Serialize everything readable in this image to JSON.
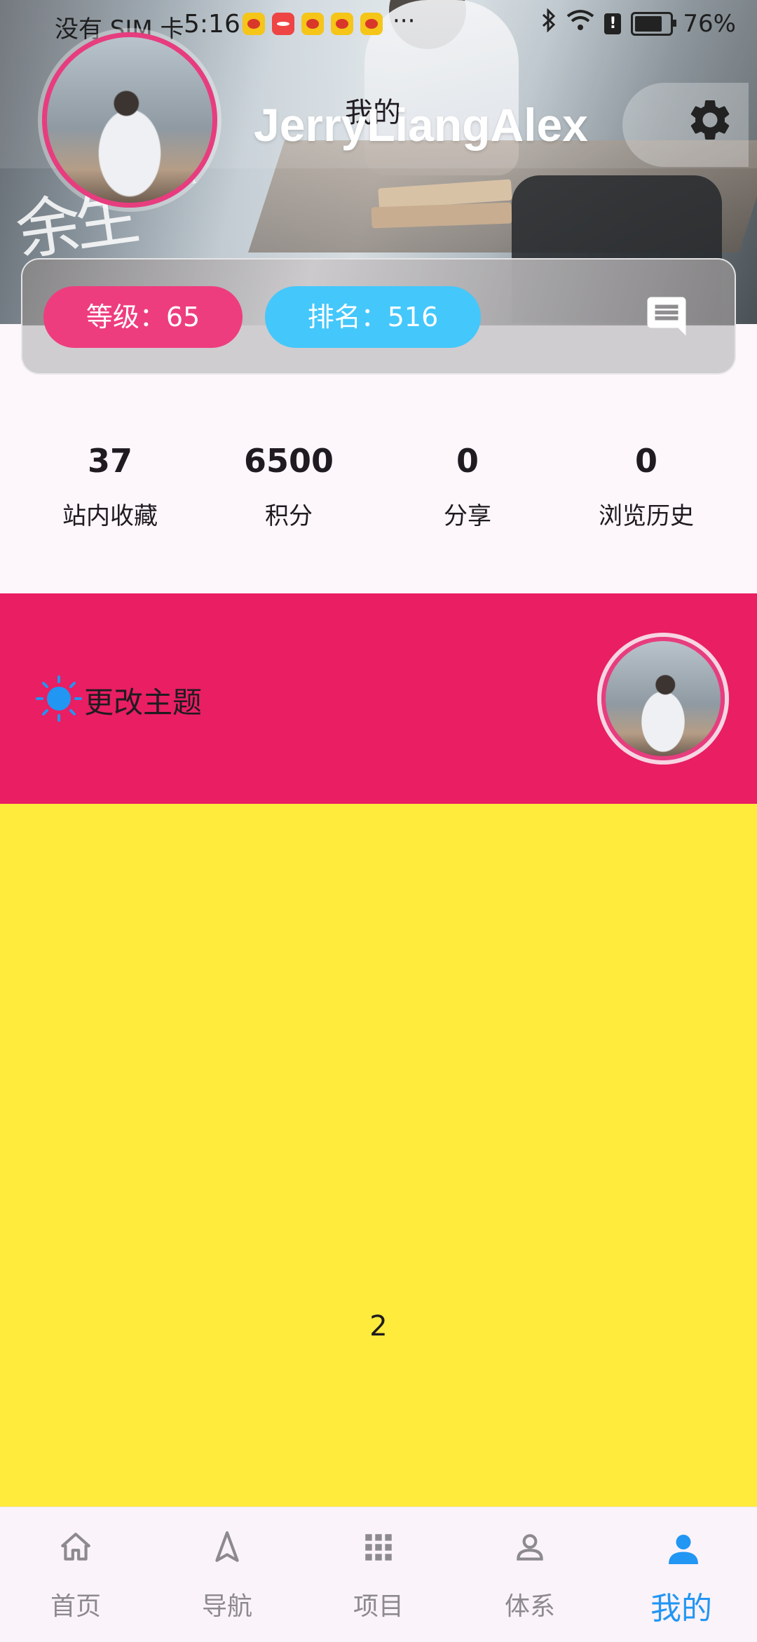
{
  "status_bar": {
    "carrier": "没有 SIM 卡",
    "time": "5:16",
    "more": "···",
    "battery": "76%"
  },
  "header": {
    "title": "我的",
    "username": "JerryLiangAlex",
    "level_label": "等级：65",
    "rank_label": "排名：516"
  },
  "stats": [
    {
      "value": "37",
      "label": "站内收藏"
    },
    {
      "value": "6500",
      "label": "积分"
    },
    {
      "value": "0",
      "label": "分享"
    },
    {
      "value": "0",
      "label": "浏览历史"
    }
  ],
  "theme": {
    "label": "更改主题",
    "background": "#e91e63"
  },
  "content": {
    "page_number": "2",
    "background": "#ffeb3b"
  },
  "bottom_nav": {
    "active_color": "#2196f3",
    "items": [
      {
        "label": "首页",
        "icon": "home-icon"
      },
      {
        "label": "导航",
        "icon": "navigation-icon"
      },
      {
        "label": "项目",
        "icon": "apps-grid-icon"
      },
      {
        "label": "体系",
        "icon": "person-outline-icon"
      },
      {
        "label": "我的",
        "icon": "person-filled-icon",
        "active": true
      }
    ]
  }
}
